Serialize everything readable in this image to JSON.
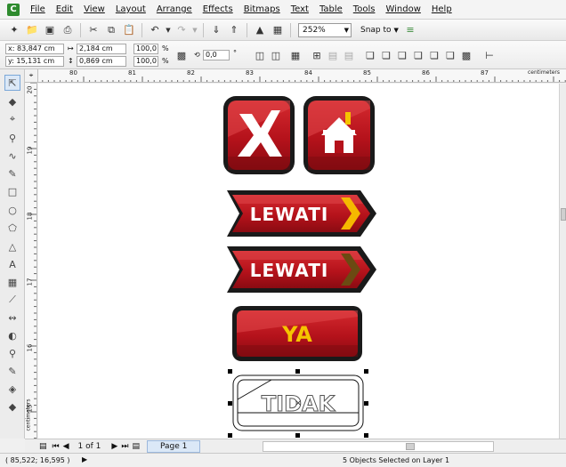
{
  "menubar": {
    "items": [
      "File",
      "Edit",
      "View",
      "Layout",
      "Arrange",
      "Effects",
      "Bitmaps",
      "Text",
      "Table",
      "Tools",
      "Window",
      "Help"
    ]
  },
  "toolbar": {
    "zoom": "252%",
    "snap_to": "Snap to"
  },
  "properties": {
    "x": "x: 83,847 cm",
    "y": "y: 15,131 cm",
    "width": "2,184 cm",
    "height": "0,869 cm",
    "scale_w": "100,0",
    "scale_h": "100,0",
    "percent": "%",
    "angle": "0,0",
    "degree": "°"
  },
  "ruler": {
    "h_ticks": [
      "80",
      "81",
      "82",
      "83",
      "84",
      "85",
      "86",
      "87"
    ],
    "h_unit": "centimeters",
    "v_ticks": [
      "20",
      "19",
      "18",
      "17",
      "16",
      "15"
    ],
    "v_unit": "centimeters"
  },
  "canvas": {
    "button_lewati_1": "LEWATI",
    "button_lewati_2": "LEWATI",
    "button_ya": "YA",
    "button_tidak": "TIDAK"
  },
  "pagenav": {
    "page_count": "1 of 1",
    "page_tab": "Page 1"
  },
  "status": {
    "coords": "( 85,522; 16,595 )",
    "message": "5 Objects Selected on Layer 1"
  },
  "colors": {
    "button_red": "#b5121b",
    "button_dark_red": "#7a0a10",
    "button_border": "#1a1a1a",
    "arrow_yellow": "#f5b800",
    "arrow_dark": "#6b4a12",
    "ya_yellow": "#f5c400"
  }
}
